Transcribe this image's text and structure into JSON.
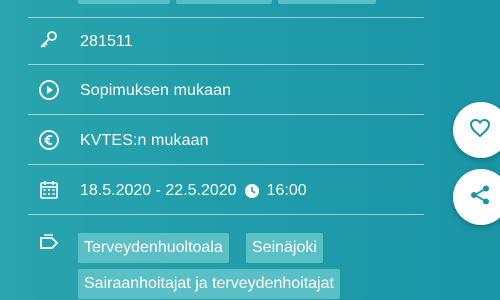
{
  "job": {
    "id": "281511",
    "duration": "Sopimuksen mukaan",
    "salary": "KVTES:n mukaan",
    "date_range": "18.5.2020 - 22.5.2020",
    "time": "16:00",
    "tags": [
      "Terveydenhuoltoala",
      "Seinäjoki",
      "Sairaanhoitajat ja terveydenhoitajat"
    ]
  },
  "icons": {
    "id": "key-icon",
    "duration": "play-circle-icon",
    "salary": "euro-circle-icon",
    "date": "calendar-icon",
    "time": "clock-icon",
    "tags": "tag-icon",
    "favorite": "heart-icon",
    "share": "share-icon"
  },
  "colors": {
    "background": "#1f9ba9",
    "chip": "#5bc0c5",
    "fab_icon": "#1a95a6"
  }
}
